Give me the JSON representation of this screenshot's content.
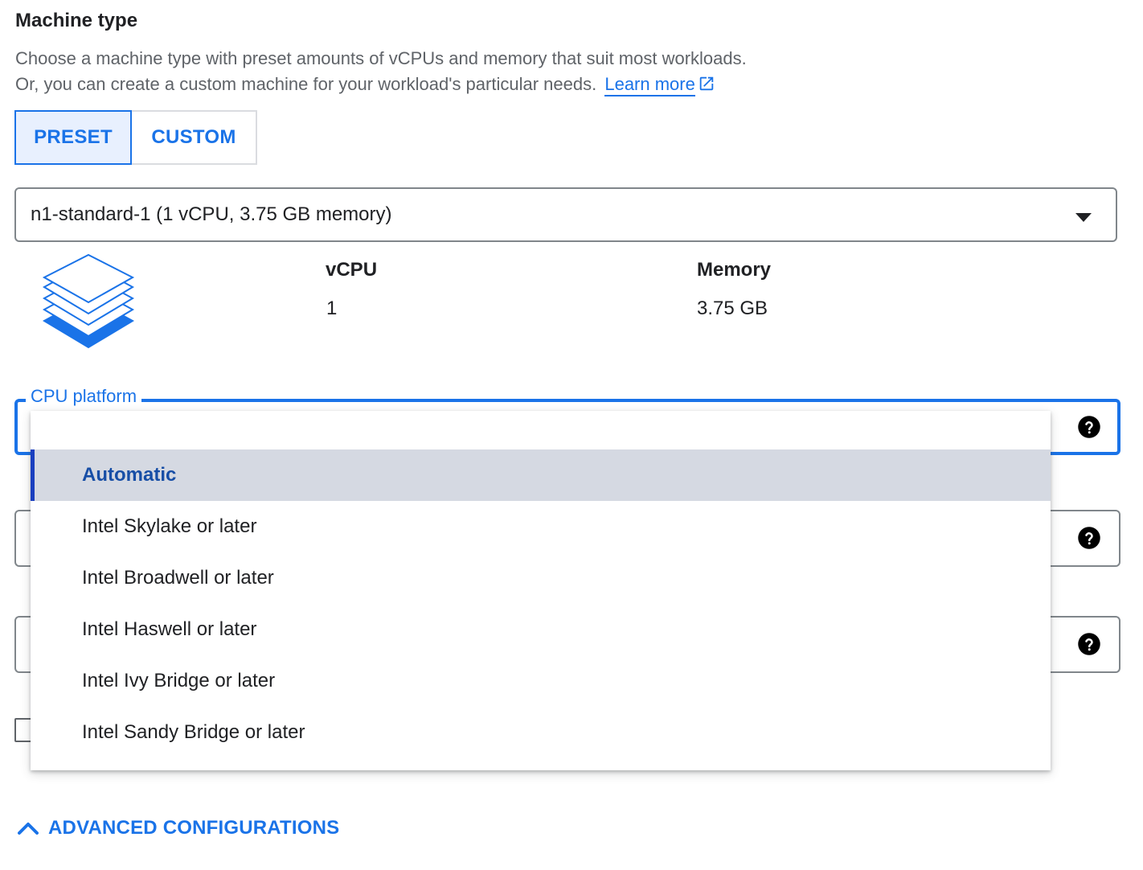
{
  "machine_type": {
    "title": "Machine type",
    "description_line1": "Choose a machine type with preset amounts of vCPUs and memory that suit most workloads.",
    "description_line2": "Or, you can create a custom machine for your workload's particular needs.",
    "learn_more": "Learn more"
  },
  "mode_toggle": {
    "preset_label": "PRESET",
    "custom_label": "CUSTOM",
    "selected": "PRESET"
  },
  "machine_select": {
    "value": "n1-standard-1 (1 vCPU, 3.75 GB memory)"
  },
  "specs": {
    "vcpu_label": "vCPU",
    "vcpu_value": "1",
    "memory_label": "Memory",
    "memory_value": "3.75 GB"
  },
  "cpu_platform": {
    "label": "CPU platform",
    "options": [
      "Automatic",
      "Intel Skylake or later",
      "Intel Broadwell or later",
      "Intel Haswell or later",
      "Intel Ivy Bridge or later",
      "Intel Sandy Bridge or later"
    ],
    "selected": "Automatic"
  },
  "advanced": {
    "label": "ADVANCED CONFIGURATIONS"
  },
  "colors": {
    "accent": "#1a73e8",
    "selected_bg": "#d5d9e2",
    "selected_text": "#174ea6",
    "secondary_text": "#5f6368"
  },
  "icons": {
    "external_link": "external-link-icon",
    "dropdown_arrow": "arrow-drop-down-icon",
    "machine": "stacked-layers-icon",
    "help": "help-icon",
    "expand": "chevron-up-icon"
  }
}
